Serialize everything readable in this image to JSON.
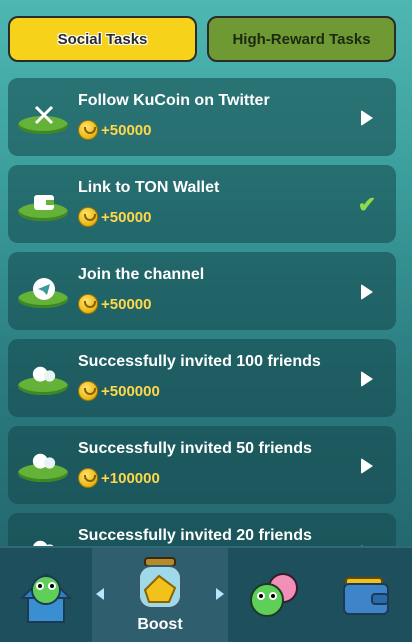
{
  "tabs": [
    {
      "label": "Social Tasks",
      "active": true
    },
    {
      "label": "High-Reward Tasks",
      "active": false
    }
  ],
  "tasks": [
    {
      "icon": "x-twitter-icon",
      "title": "Follow KuCoin on Twitter",
      "reward": "+50000",
      "status": "open"
    },
    {
      "icon": "wallet-icon",
      "title": "Link to TON Wallet",
      "reward": "+50000",
      "status": "done"
    },
    {
      "icon": "telegram-icon",
      "title": "Join the channel",
      "reward": "+50000",
      "status": "open"
    },
    {
      "icon": "friends-icon",
      "title": "Successfully invited 100 friends",
      "reward": "+500000",
      "status": "open"
    },
    {
      "icon": "friends-icon",
      "title": "Successfully invited 50 friends",
      "reward": "+100000",
      "status": "open"
    },
    {
      "icon": "friends-icon",
      "title": "Successfully invited 20 friends",
      "reward": "",
      "status": "open"
    }
  ],
  "nav": {
    "home_icon": "frog-house-icon",
    "boost_icon": "coin-jar-icon",
    "boost_label": "Boost",
    "friends_icon": "frogs-icon",
    "wallet_icon": "wallet-icon"
  }
}
